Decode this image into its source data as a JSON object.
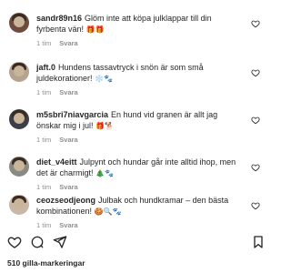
{
  "comments": [
    {
      "user": "sandr89n16",
      "text": "Glöm inte att köpa julklappar till din fyrbenta vän!",
      "emoji": "🎁🎁",
      "time": "1 tim",
      "reply": "Svara"
    },
    {
      "user": "jaft.0",
      "text": "Hundens tassavtryck i snön är som små juldekorationer!",
      "emoji": "❄️🐾",
      "time": "1 tim",
      "reply": "Svara"
    },
    {
      "user": "m5sbri7niavgarcia",
      "text": "En hund vid granen är allt jag önskar mig i jul!",
      "emoji": "🎁🐕",
      "time": "1 tim",
      "reply": "Svara"
    },
    {
      "user": "diet_v4eitt",
      "text": "Julpynt och hundar går inte alltid ihop, men det är charmigt!",
      "emoji": "🎄🐾",
      "time": "1 tim",
      "reply": "Svara"
    },
    {
      "user": "ceozseodjeong",
      "text": "Julbak och hundkramar – den bästa kombinationen!",
      "emoji": "🍪🔍🐾",
      "time": "1 tim",
      "reply": "Svara"
    }
  ],
  "post": {
    "likes": "510 gilla-markeringar"
  },
  "icons": {
    "heart": "heart-icon",
    "like": "heart-icon",
    "comment": "comment-icon",
    "share": "share-icon",
    "save": "bookmark-icon"
  }
}
